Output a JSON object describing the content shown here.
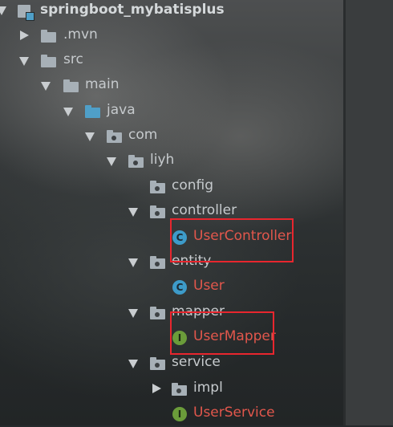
{
  "project_tree": {
    "root": "springboot_mybatisplus",
    "mvn": ".mvn",
    "src": "src",
    "main": "main",
    "java": "java",
    "com": "com",
    "liyh": "liyh",
    "config": "config",
    "controller": "controller",
    "user_controller": "UserController",
    "entity": "entity",
    "user": "User",
    "mapper": "mapper",
    "user_mapper": "UserMapper",
    "service": "service",
    "impl": "impl",
    "user_service": "UserService",
    "class_badge": "C",
    "interface_badge": "I"
  },
  "colors": {
    "highlight_box": "#e8262e",
    "modified_file_text": "#e2574c",
    "source_folder": "#4f9fc8",
    "folder": "#a7b0b7"
  },
  "icons": {
    "expanded": "triangle-down",
    "collapsed": "triangle-right",
    "module": "module-icon",
    "package": "package-folder-icon",
    "class": "class-c-icon",
    "interface": "interface-i-icon"
  }
}
